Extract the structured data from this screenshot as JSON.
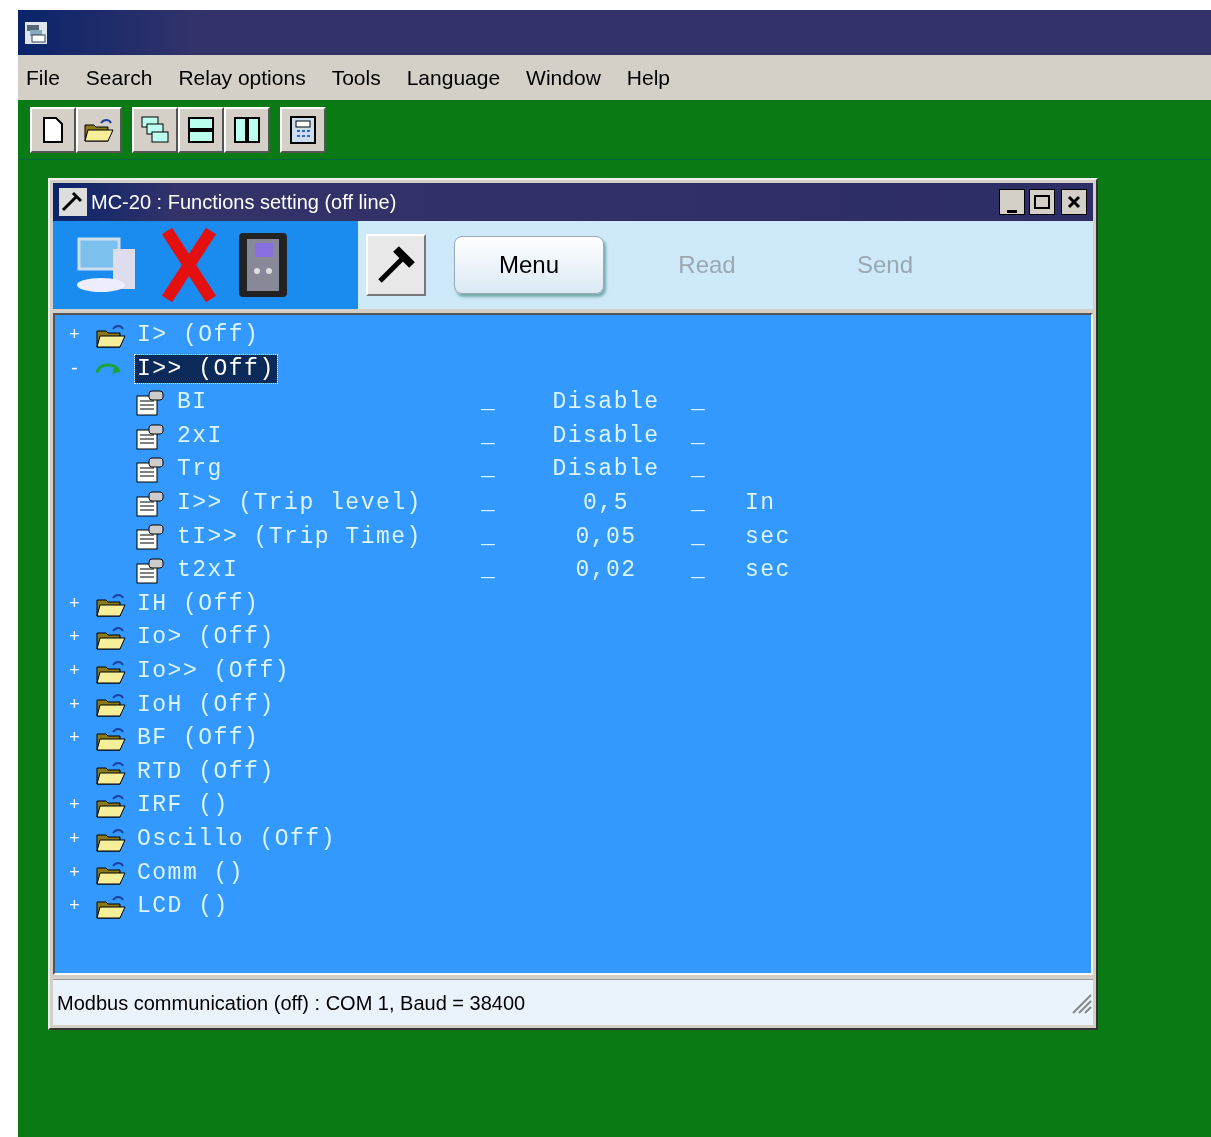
{
  "menu_bar": [
    "File",
    "Search",
    "Relay options",
    "Tools",
    "Language",
    "Window",
    "Help"
  ],
  "child_window": {
    "title": "MC-20 : Functions setting (off line)",
    "buttons": [
      {
        "label": "Menu",
        "disabled": false
      },
      {
        "label": "Read",
        "disabled": true
      },
      {
        "label": "Send",
        "disabled": true
      }
    ],
    "tree": [
      {
        "label": "I> (Off)",
        "expander": "+",
        "selected": false
      },
      {
        "label": "I>> (Off)",
        "expander": "-",
        "selected": true,
        "children": [
          {
            "name": "BI",
            "sep_left": "_",
            "value": "Disable",
            "sep_right": "_"
          },
          {
            "name": "2xI",
            "sep_left": "_",
            "value": "Disable",
            "sep_right": "_"
          },
          {
            "name": "Trg",
            "sep_left": "_",
            "value": "Disable",
            "sep_right": "_"
          },
          {
            "name": "I>> (Trip level)",
            "sep_left": "_",
            "value": "0,5",
            "sep_right": "_",
            "unit": "In"
          },
          {
            "name": "tI>> (Trip Time)",
            "sep_left": "_",
            "value": "0,05",
            "sep_right": "_",
            "unit": "sec"
          },
          {
            "name": "t2xI",
            "sep_left": "_",
            "value": "0,02",
            "sep_right": "_",
            "unit": "sec"
          }
        ]
      },
      {
        "label": "IH (Off)",
        "expander": "+",
        "selected": false
      },
      {
        "label": "Io> (Off)",
        "expander": "+",
        "selected": false
      },
      {
        "label": "Io>> (Off)",
        "expander": "+",
        "selected": false
      },
      {
        "label": "IoH (Off)",
        "expander": "+",
        "selected": false
      },
      {
        "label": "BF (Off)",
        "expander": "+",
        "selected": false
      },
      {
        "label": "RTD (Off)",
        "selected": false
      },
      {
        "label": "IRF ()",
        "expander": "+",
        "selected": false
      },
      {
        "label": "Oscillo (Off)",
        "expander": "+",
        "selected": false
      },
      {
        "label": "Comm ()",
        "expander": "+",
        "selected": false
      },
      {
        "label": "LCD ()",
        "expander": "+",
        "selected": false
      }
    ],
    "status_bar": "Modbus communication (off) : COM 1, Baud = 38400"
  }
}
